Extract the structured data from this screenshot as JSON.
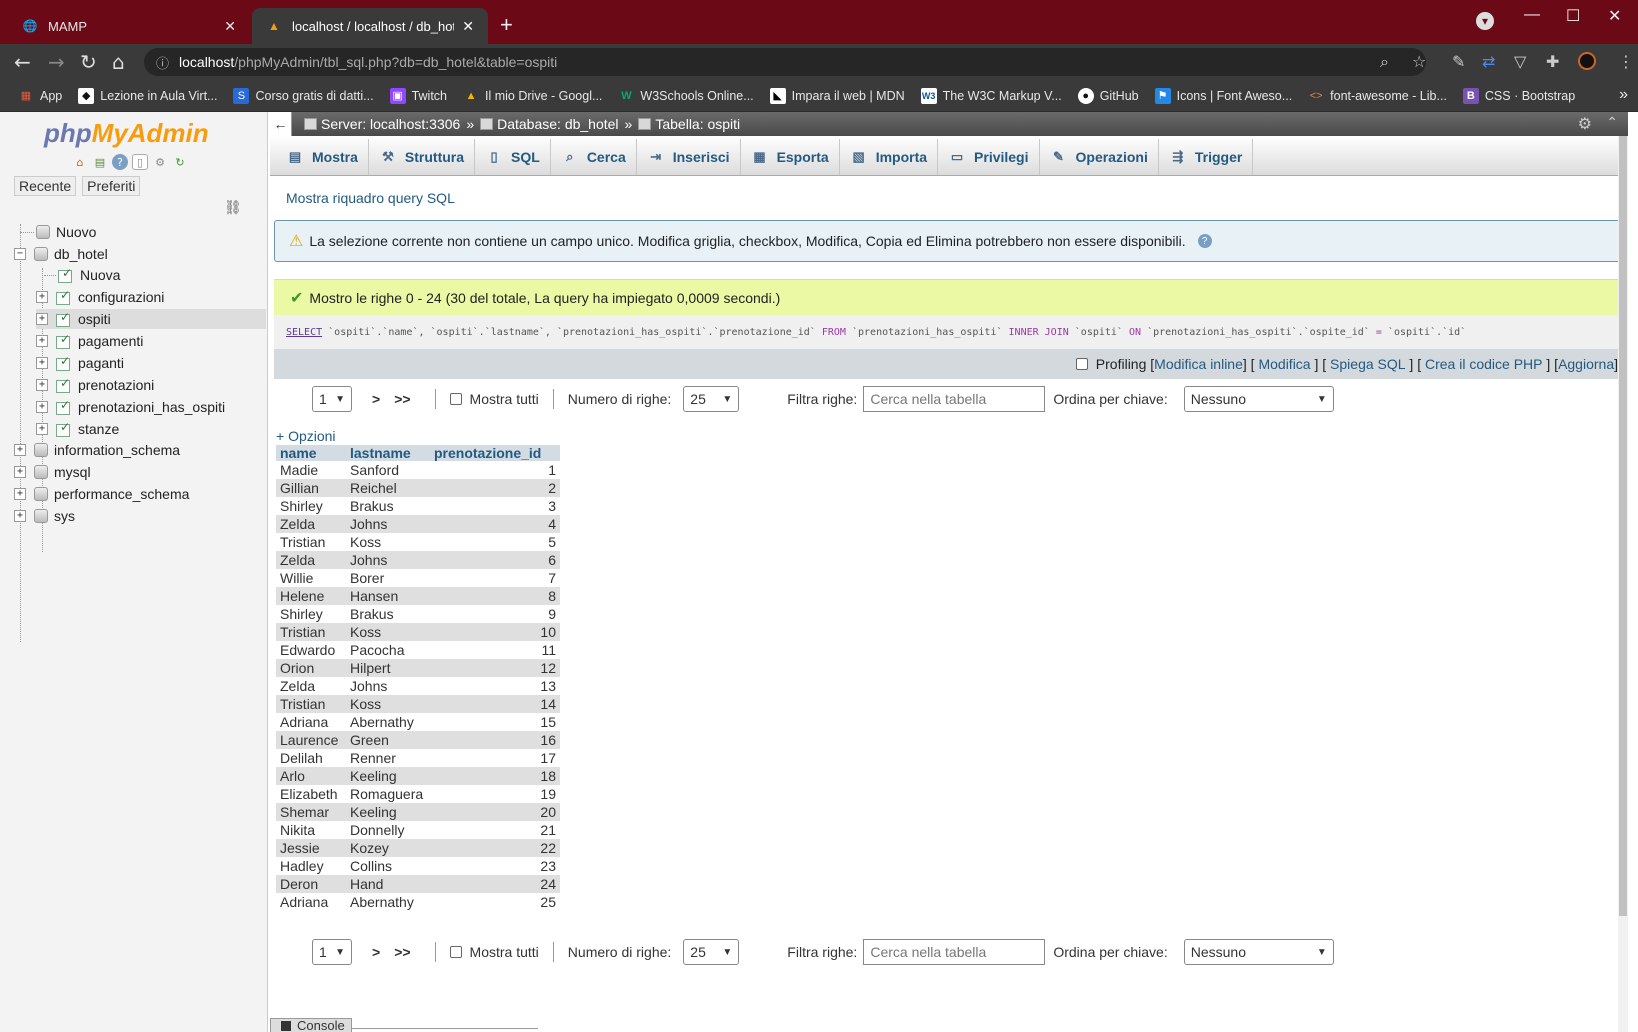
{
  "browser": {
    "tabs": [
      {
        "title": "MAMP",
        "active": false
      },
      {
        "title": "localhost / localhost / db_hotel / ",
        "active": true
      }
    ],
    "url_host": "localhost",
    "url_path": "/phpMyAdmin/tbl_sql.php?db=db_hotel&table=ospiti",
    "bookmarks": [
      {
        "label": "App",
        "icon": "apps-grid-icon",
        "color": "#e35a3a"
      },
      {
        "label": "Lezione in Aula Virt...",
        "icon": "classroom-icon",
        "color": "#1a1a1a"
      },
      {
        "label": "Corso gratis di datti...",
        "icon": "typing-icon",
        "color": "#2a6ad6"
      },
      {
        "label": "Twitch",
        "icon": "twitch-icon",
        "color": "#9146ff"
      },
      {
        "label": "Il mio Drive - Googl...",
        "icon": "drive-icon",
        "color": "#f4b400"
      },
      {
        "label": "W3Schools Online...",
        "icon": "w3schools-icon",
        "color": "#04aa6d"
      },
      {
        "label": "Impara il web | MDN",
        "icon": "mdn-icon",
        "color": "#000000"
      },
      {
        "label": "The W3C Markup V...",
        "icon": "w3c-icon",
        "color": "#005a9c"
      },
      {
        "label": "GitHub",
        "icon": "github-icon",
        "color": "#ffffff"
      },
      {
        "label": "Icons | Font Aweso...",
        "icon": "fontawesome-icon",
        "color": "#228ae6"
      },
      {
        "label": "font-awesome - Lib...",
        "icon": "code-icon",
        "color": "#e8814a"
      },
      {
        "label": "CSS · Bootstrap",
        "icon": "bootstrap-icon",
        "color": "#7952b3"
      }
    ]
  },
  "nav": {
    "logo_php": "php",
    "logo_ma": "MyAdmin",
    "tabs": [
      "Recente",
      "Preferiti"
    ],
    "tree": {
      "new": "Nuovo",
      "db_hotel": "db_hotel",
      "db_hotel_new": "Nuova",
      "tables": [
        "configurazioni",
        "ospiti",
        "pagamenti",
        "paganti",
        "prenotazioni",
        "prenotazioni_has_ospiti",
        "stanze"
      ],
      "selected_table": "ospiti",
      "databases": [
        "information_schema",
        "mysql",
        "performance_schema",
        "sys"
      ]
    }
  },
  "breadcrumb": {
    "server": "Server: localhost:3306",
    "database": "Database: db_hotel",
    "table": "Tabella: ospiti",
    "sep": "»"
  },
  "menu": [
    {
      "label": "Mostra",
      "icon": "browse-icon"
    },
    {
      "label": "Struttura",
      "icon": "structure-icon"
    },
    {
      "label": "SQL",
      "icon": "sql-icon"
    },
    {
      "label": "Cerca",
      "icon": "search-icon"
    },
    {
      "label": "Inserisci",
      "icon": "insert-icon"
    },
    {
      "label": "Esporta",
      "icon": "export-icon"
    },
    {
      "label": "Importa",
      "icon": "import-icon"
    },
    {
      "label": "Privilegi",
      "icon": "privileges-icon"
    },
    {
      "label": "Operazioni",
      "icon": "operations-icon"
    },
    {
      "label": "Trigger",
      "icon": "trigger-icon"
    }
  ],
  "sql_toggle": "Mostra riquadro query SQL",
  "warning": "La selezione corrente non contiene un campo unico. Modifica griglia, checkbox, Modifica, Copia ed Elimina potrebbero non essere disponibili.",
  "success": "Mostro le righe 0 - 24 (30 del totale, La query ha impiegato 0,0009 secondi.)",
  "sql": {
    "select": "SELECT",
    "cols": "`ospiti`.`name`, `ospiti`.`lastname`, `prenotazioni_has_ospiti`.`prenotazione_id`",
    "from": "FROM",
    "tbl1": "`prenotazioni_has_ospiti`",
    "join": "INNER JOIN",
    "tbl2": "`ospiti`",
    "on": "ON",
    "cond1": "`prenotazioni_has_ospiti`.`ospite_id`",
    "eq": "=",
    "cond2": "`ospiti`.`id`"
  },
  "sql_tools": {
    "profiling": "Profiling",
    "links": [
      "Modifica inline",
      "Modifica",
      "Spiega SQL",
      "Crea il codice PHP",
      "Aggiorna"
    ]
  },
  "pager": {
    "page": "1",
    "next": ">",
    "last": ">>",
    "show_all": "Mostra tutti",
    "rows_label": "Numero di righe:",
    "rows_value": "25",
    "filter_label": "Filtra righe:",
    "filter_placeholder": "Cerca nella tabella",
    "sort_label": "Ordina per chiave:",
    "sort_value": "Nessuno"
  },
  "options_link": "+ Opzioni",
  "table": {
    "headers": [
      "name",
      "lastname",
      "prenotazione_id"
    ],
    "rows": [
      [
        "Madie",
        "Sanford",
        "1"
      ],
      [
        "Gillian",
        "Reichel",
        "2"
      ],
      [
        "Shirley",
        "Brakus",
        "3"
      ],
      [
        "Zelda",
        "Johns",
        "4"
      ],
      [
        "Tristian",
        "Koss",
        "5"
      ],
      [
        "Zelda",
        "Johns",
        "6"
      ],
      [
        "Willie",
        "Borer",
        "7"
      ],
      [
        "Helene",
        "Hansen",
        "8"
      ],
      [
        "Shirley",
        "Brakus",
        "9"
      ],
      [
        "Tristian",
        "Koss",
        "10"
      ],
      [
        "Edwardo",
        "Pacocha",
        "11"
      ],
      [
        "Orion",
        "Hilpert",
        "12"
      ],
      [
        "Zelda",
        "Johns",
        "13"
      ],
      [
        "Tristian",
        "Koss",
        "14"
      ],
      [
        "Adriana",
        "Abernathy",
        "15"
      ],
      [
        "Laurence",
        "Green",
        "16"
      ],
      [
        "Delilah",
        "Renner",
        "17"
      ],
      [
        "Arlo",
        "Keeling",
        "18"
      ],
      [
        "Elizabeth",
        "Romaguera",
        "19"
      ],
      [
        "Shemar",
        "Keeling",
        "20"
      ],
      [
        "Nikita",
        "Donnelly",
        "21"
      ],
      [
        "Jessie",
        "Kozey",
        "22"
      ],
      [
        "Hadley",
        "Collins",
        "23"
      ],
      [
        "Deron",
        "Hand",
        "24"
      ],
      [
        "Adriana",
        "Abernathy",
        "25"
      ]
    ]
  },
  "console": "Console"
}
